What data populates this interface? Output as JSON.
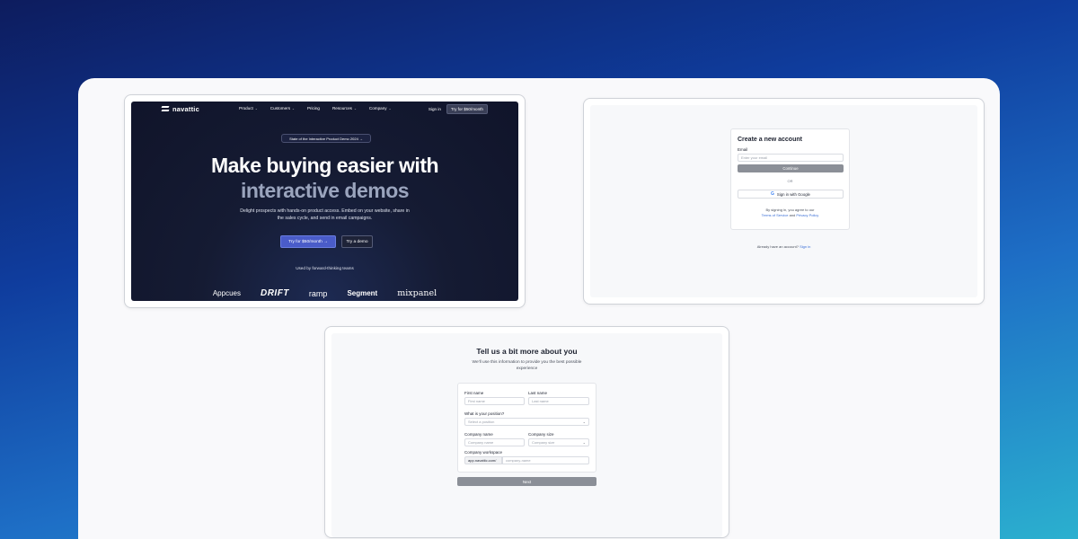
{
  "landing": {
    "logo_text": "navattic",
    "menu": [
      {
        "label": "Product",
        "chevron": true
      },
      {
        "label": "Customers",
        "chevron": true
      },
      {
        "label": "Pricing",
        "chevron": false
      },
      {
        "label": "Resources",
        "chevron": true
      },
      {
        "label": "Company",
        "chevron": true
      }
    ],
    "sign_in": "Sign in",
    "nav_cta": "Try for $50/month",
    "announcement": "State of the Interactive Product Demo 2024 →",
    "headline_line1": "Make buying easier with",
    "headline_line2": "interactive demos",
    "subheadline": "Delight prospects with hands-on product access. Embed on your website, share in the sales cycle, and send in email campaigns.",
    "primary_cta": "Try for $50/month →",
    "secondary_cta": "Try a demo",
    "social_proof": "Used by forward-thinking teams",
    "customer_logos": [
      "Appcues",
      "DRIFT",
      "ramp",
      "Segment",
      "mixpanel"
    ]
  },
  "signup": {
    "title": "Create a new account",
    "email_label": "Email",
    "email_placeholder": "Enter your email",
    "continue": "Continue",
    "or": "OR",
    "google": "Sign in with Google",
    "terms_line1": "By signing in, you agree to our",
    "terms_link1": "Terms of Service",
    "terms_and": "and",
    "terms_link2": "Privacy Policy",
    "already": "Already have an account?",
    "sign_in_link": "Sign in"
  },
  "onboarding": {
    "title": "Tell us a bit more about you",
    "subtitle": "We'll use this information to provide you the best possible experience",
    "first_name_label": "First name",
    "first_name_placeholder": "First name",
    "last_name_label": "Last name",
    "last_name_placeholder": "Last name",
    "position_label": "What is your position?",
    "position_placeholder": "Select a position",
    "company_name_label": "Company name",
    "company_name_placeholder": "Company name",
    "company_size_label": "Company size",
    "company_size_placeholder": "Company size",
    "workspace_label": "Company workspace",
    "workspace_prefix": "app.navattic.com/",
    "workspace_placeholder": "company-name",
    "next": "Next"
  }
}
